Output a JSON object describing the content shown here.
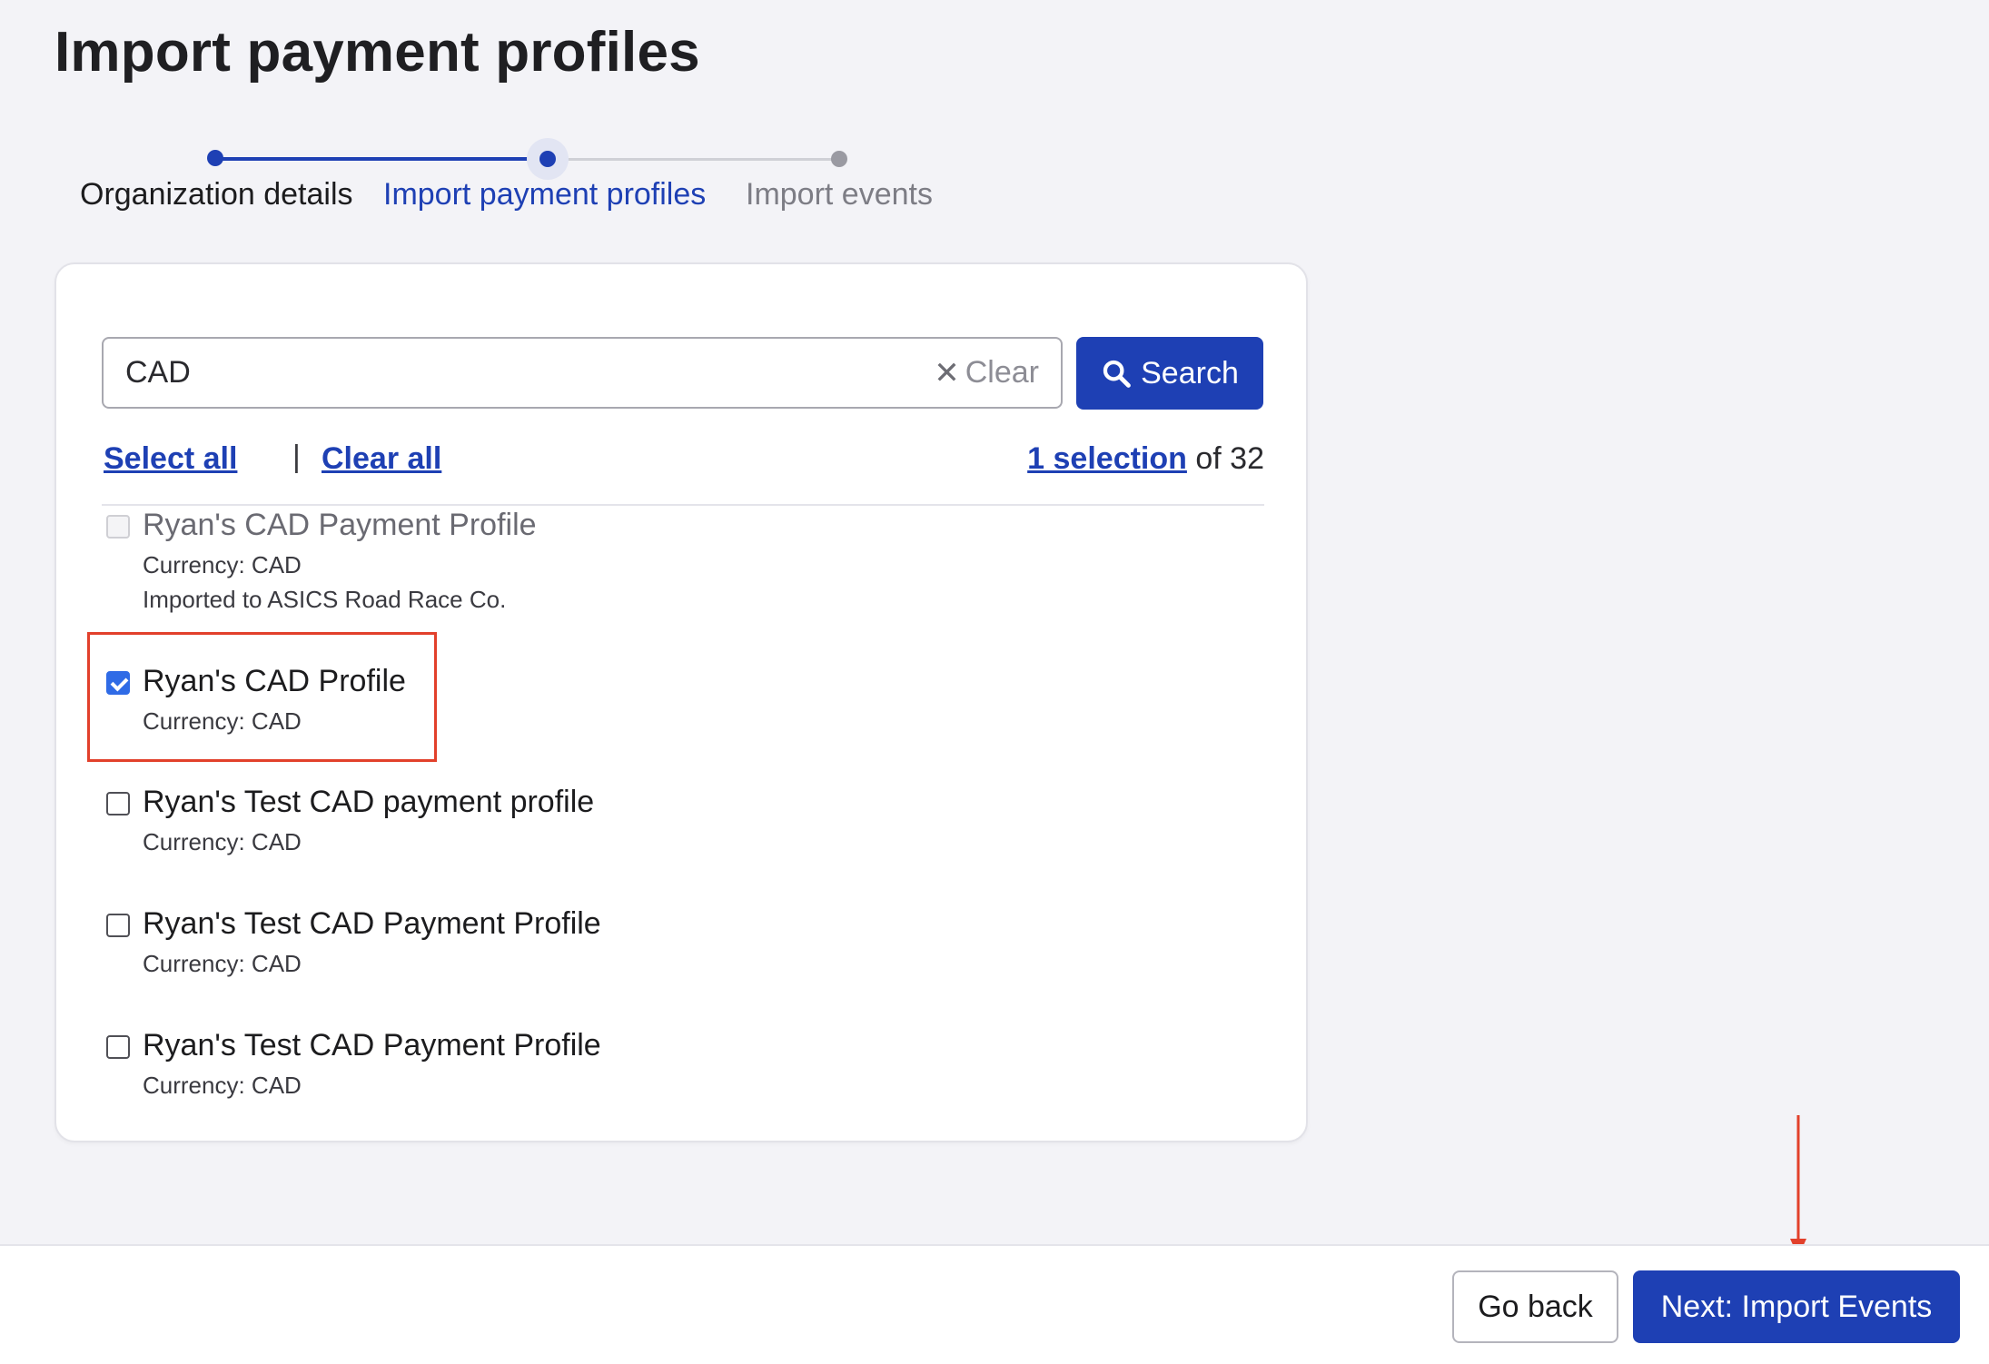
{
  "page": {
    "title": "Import payment profiles"
  },
  "stepper": {
    "steps": [
      {
        "label": "Organization details",
        "state": "complete"
      },
      {
        "label": "Import payment profiles",
        "state": "current"
      },
      {
        "label": "Import events",
        "state": "upcoming"
      }
    ]
  },
  "search": {
    "value": "CAD",
    "clear_label": "Clear",
    "button_label": "Search"
  },
  "toolbar": {
    "select_all": "Select all",
    "separator": "|",
    "clear_all": "Clear all",
    "selection_link": "1 selection",
    "selection_total": "of 32"
  },
  "profiles": [
    {
      "name": "Ryan's CAD Payment Profile",
      "currency": "Currency: CAD",
      "note": "Imported to ASICS Road Race Co.",
      "checked": false,
      "disabled": true
    },
    {
      "name": "Ryan's CAD Profile",
      "currency": "Currency: CAD",
      "checked": true,
      "disabled": false
    },
    {
      "name": "Ryan's Test CAD payment profile",
      "currency": "Currency: CAD",
      "checked": false,
      "disabled": false
    },
    {
      "name": "Ryan's Test CAD Payment Profile",
      "currency": "Currency: CAD",
      "checked": false,
      "disabled": false
    },
    {
      "name": "Ryan's Test CAD Payment Profile",
      "currency": "Currency: CAD",
      "checked": false,
      "disabled": false
    }
  ],
  "footer": {
    "go_back": "Go back",
    "next": "Next: Import Events"
  },
  "colors": {
    "primary": "#1e40b4",
    "checkbox_checked": "#2f6be6",
    "annotation": "#e2402b"
  }
}
